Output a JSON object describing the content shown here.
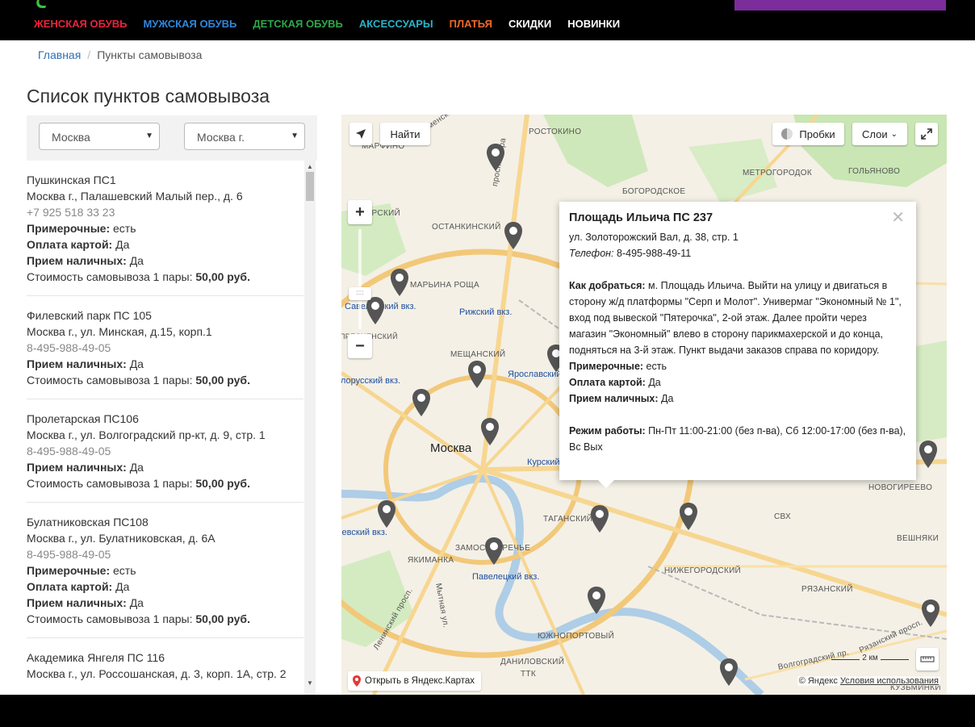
{
  "nav": {
    "items": [
      {
        "label": "ЖЕНСКАЯ ОБУВЬ",
        "color": "#e8243c"
      },
      {
        "label": "МУЖСКАЯ ОБУВЬ",
        "color": "#2f86d9"
      },
      {
        "label": "ДЕТСКАЯ ОБУВЬ",
        "color": "#2ea84a"
      },
      {
        "label": "АКСЕССУАРЫ",
        "color": "#2bb3c8"
      },
      {
        "label": "ПЛАТЬЯ",
        "color": "#f06a2a"
      },
      {
        "label": "СКИДКИ",
        "color": "#ffffff"
      },
      {
        "label": "НОВИНКИ",
        "color": "#ffffff"
      }
    ]
  },
  "breadcrumb": {
    "home": "Главная",
    "separator": "/",
    "current": "Пункты самовывоза"
  },
  "page_title": "Список пунктов самовывоза",
  "filters": {
    "city": "Москва",
    "locality": "Москва г."
  },
  "pickup_points": [
    {
      "name": "Пушкинская ПС1",
      "address": "Москва г., Палашевский Малый пер., д. 6",
      "phone": "+7 925 518 33 23",
      "fitting_label": "Примерочные:",
      "fitting": "есть",
      "card_label": "Оплата картой:",
      "card": "Да",
      "cash_label": "Прием наличных:",
      "cash": "Да",
      "price_label": "Стоимость самовывоза 1 пары:",
      "price": "50,00 руб."
    },
    {
      "name": "Филевский парк ПС 105",
      "address": "Москва г., ул. Минская, д.15, корп.1",
      "phone": "8-495-988-49-05",
      "cash_label": "Прием наличных:",
      "cash": "Да",
      "price_label": "Стоимость самовывоза 1 пары:",
      "price": "50,00 руб."
    },
    {
      "name": "Пролетарская ПС106",
      "address": "Москва г., ул. Волгоградский пр-кт, д. 9, стр. 1",
      "phone": "8-495-988-49-05",
      "cash_label": "Прием наличных:",
      "cash": "Да",
      "price_label": "Стоимость самовывоза 1 пары:",
      "price": "50,00 руб."
    },
    {
      "name": "Булатниковская ПС108",
      "address": "Москва г., ул. Булатниковская, д. 6А",
      "phone": "8-495-988-49-05",
      "fitting_label": "Примерочные:",
      "fitting": "есть",
      "card_label": "Оплата картой:",
      "card": "Да",
      "cash_label": "Прием наличных:",
      "cash": "Да",
      "price_label": "Стоимость самовывоза 1 пары:",
      "price": "50,00 руб."
    },
    {
      "name": "Академика Янгеля ПС 116",
      "address": "Москва г., ул. Россошанская, д. 3, корп. 1А, стр. 2"
    }
  ],
  "map": {
    "find_button": "Найти",
    "traffic_button": "Пробки",
    "layers_button": "Слои",
    "open_in_yandex": "Открыть в Яндекс.Картах",
    "copyright": "© Яндекс",
    "terms": "Условия использования",
    "scale": "2 км",
    "city_label": "Москва",
    "labels": [
      "РОСТОКИНО",
      "МАРФИНО",
      "МЕТРОГОРОДОК",
      "ГОЛЬЯНОВО",
      "БОГОРОДСКОЕ",
      "ТЫРСКИЙ",
      "ОСТАНКИНСКИЙ",
      "МАРЬИНА РОЩА",
      "МЕЩАНСКИЙ",
      "ТАГАНСКИЙ",
      "ЗАМОСКВОРЕЧЬЕ",
      "ЯКИМАНКА",
      "НИЖЕГОРОДСКИЙ",
      "РЯЗАНСКИЙ",
      "ЮЖНОПОРТОВЫЙ",
      "ДАНИЛОВСКИЙ",
      "НОВОГИРЕЕВО",
      "ВЕШНЯКИ",
      "КУЗЬМИНКИ",
      "ТТК",
      "СВХ",
      "ПРЕСНЕНСКИЙ"
    ],
    "stations": [
      "Савеловский вкз.",
      "Рижский вкз.",
      "Ярославский",
      "Белорусский вкз.",
      "Курский",
      "Павелецкий вкз.",
      "Киевский вкз."
    ],
    "roads": [
      "просп. Мира",
      "Ленинский просп.",
      "Мытная ул.",
      "Волгоградский пр.",
      "Рязанский просп.",
      "Каменская"
    ],
    "pin_color": "#555555"
  },
  "balloon": {
    "title": "Площадь Ильича ПС 237",
    "address": "ул. Золоторожский Вал, д. 38, стр. 1",
    "phone_label": "Телефон:",
    "phone": "8-495-988-49-11",
    "directions_label": "Как добраться:",
    "directions": "м. Площадь Ильича. Выйти на улицу и двигаться в сторону ж/д платформы \"Серп и Молот\". Универмаг \"Экономный № 1\", вход под вывеской \"Пятерочка\", 2-ой этаж. Далее пройти через магазин \"Экономный\" влево в сторону парикмахерской и до конца, подняться на 3-й этаж. Пункт выдачи заказов справа по коридору.",
    "fitting_label": "Примерочные:",
    "fitting": "есть",
    "card_label": "Оплата картой:",
    "card": "Да",
    "cash_label": "Прием наличных:",
    "cash": "Да",
    "hours_label": "Режим работы:",
    "hours": "Пн-Пт 11:00-21:00 (без п-ва), Сб 12:00-17:00 (без п-ва), Вс Вых"
  }
}
